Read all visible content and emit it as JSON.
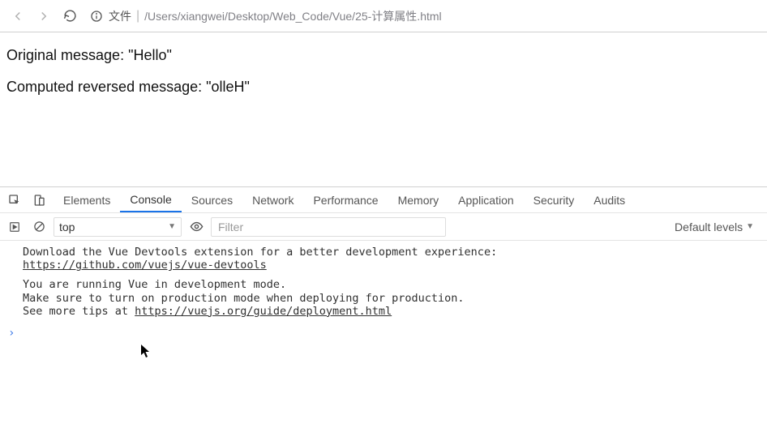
{
  "toolbar": {
    "file_label": "文件",
    "path": "/Users/xiangwei/Desktop/Web_Code/Vue/25-计算属性.html"
  },
  "page": {
    "line1": "Original message: \"Hello\"",
    "line2": "Computed reversed message: \"olleH\""
  },
  "devtools": {
    "tabs": [
      "Elements",
      "Console",
      "Sources",
      "Network",
      "Performance",
      "Memory",
      "Application",
      "Security",
      "Audits"
    ],
    "active_tab": "Console",
    "context": "top",
    "filter_placeholder": "Filter",
    "levels_label": "Default levels",
    "log": {
      "msg1_text": "Download the Vue Devtools extension for a better development experience: ",
      "msg1_link": "https://github.com/vuejs/vue-devtools",
      "msg2_pre": "You are running Vue in development mode.\nMake sure to turn on production mode when deploying for production.\nSee more tips at ",
      "msg2_link": "https://vuejs.org/guide/deployment.html"
    },
    "prompt_glyph": "›"
  }
}
